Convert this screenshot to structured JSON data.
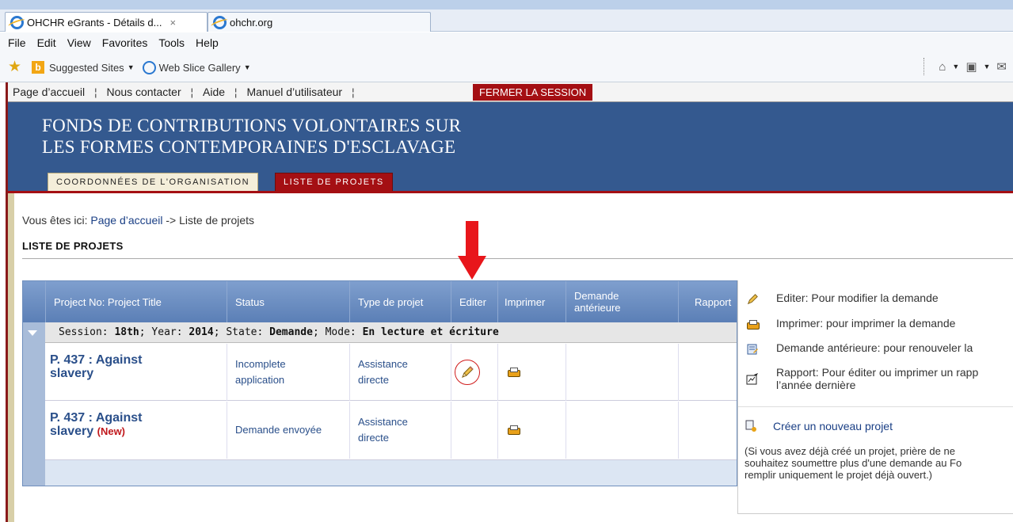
{
  "browser": {
    "tabs": [
      {
        "label": "OHCHR eGrants - Détails d...",
        "close": "×"
      },
      {
        "label": "ohchr.org"
      }
    ],
    "menu": [
      "File",
      "Edit",
      "View",
      "Favorites",
      "Tools",
      "Help"
    ],
    "favorites": {
      "suggested_sites": "Suggested Sites",
      "web_slice_gallery": "Web Slice Gallery"
    }
  },
  "site_nav": {
    "home": "Page d’accueil",
    "contact": "Nous contacter",
    "help": "Aide",
    "manual": "Manuel d’utilisateur",
    "separator": "¦",
    "logout": "FERMER LA SESSION"
  },
  "banner": {
    "title_line1": "FONDS DE CONTRIBUTIONS VOLONTAIRES SUR",
    "title_line2": "LES FORMES CONTEMPORAINES D'ESCLAVAGE",
    "tab_org": "COORDONNÉES DE L'ORGANISATION",
    "tab_projects": "LISTE DE PROJETS"
  },
  "breadcrumb": {
    "prefix": "Vous êtes ici:",
    "home_link": "Page d’accueil",
    "current": "-> Liste de projets"
  },
  "page_title": "LISTE DE PROJETS",
  "grid": {
    "headers": [
      "Project No: Project Title",
      "Status",
      "Type de projet",
      "Editer",
      "Imprimer",
      "Demande antérieure",
      "Rapport"
    ],
    "group": {
      "session_label": "Session:",
      "session": "18th",
      "year_label": "; Year:",
      "year": "2014",
      "state_label": "; State:",
      "state": "Demande",
      "mode_label": "; Mode:",
      "mode": "En lecture et écriture"
    },
    "rows": [
      {
        "title": "P. 437 : Against slavery",
        "new": "",
        "status": "Incomplete application",
        "type": "Assistance directe"
      },
      {
        "title": "P. 437 : Against slavery",
        "new": "(New)",
        "status": "Demande envoyée",
        "type": "Assistance directe"
      }
    ]
  },
  "legend": {
    "edit": "Editer: Pour modifier la demande",
    "print": "Imprimer: pour imprimer la demande",
    "previous": "Demande antérieure: pour renouveler la",
    "report_line1": "Rapport: Pour éditer ou imprimer un rapp",
    "report_line2": "l’année dernière",
    "create": "Créer un nouveau projet",
    "note_line1": "(Si vous avez déjà créé un projet, prière de ne",
    "note_line2": "souhaitez soumettre plus d'une demande au Fo",
    "note_line3": "remplir uniquement le projet déjà ouvert.)"
  },
  "colors": {
    "banner_blue": "#34598f",
    "accent_red": "#a40f13",
    "grid_header": "#6a8ec3"
  }
}
